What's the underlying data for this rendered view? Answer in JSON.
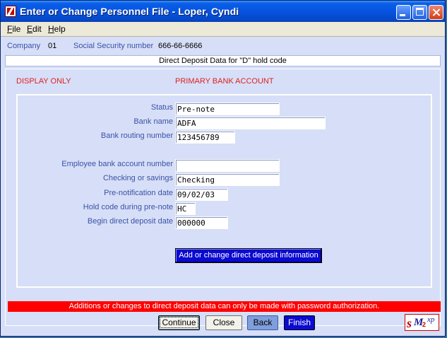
{
  "window": {
    "title": "Enter or Change Personnel File - Loper, Cyndi"
  },
  "menu": {
    "items": [
      {
        "label": "File",
        "accel": "F",
        "rest": "ile"
      },
      {
        "label": "Edit",
        "accel": "E",
        "rest": "dit"
      },
      {
        "label": "Help",
        "accel": "H",
        "rest": "elp"
      }
    ]
  },
  "info": {
    "company_label": "Company",
    "company_value": "01",
    "ssn_label": "Social Security number",
    "ssn_value": "666-66-6666"
  },
  "section_title": "Direct Deposit Data for \"D\" hold code",
  "display_only": "DISPLAY ONLY",
  "primary_account": "PRIMARY BANK ACCOUNT",
  "fields": {
    "status": {
      "label": "Status",
      "value": "Pre-note"
    },
    "bank_name": {
      "label": "Bank name",
      "value": "ADFA"
    },
    "routing": {
      "label": "Bank routing number",
      "value": "123456789"
    },
    "account_number": {
      "label": "Employee bank account number",
      "value": ""
    },
    "checking_savings": {
      "label": "Checking or savings",
      "value": "Checking"
    },
    "prenote_date": {
      "label": "Pre-notification date",
      "value": "09/02/03"
    },
    "hold_code": {
      "label": "Hold code during pre-note",
      "value": "HC"
    },
    "begin_date": {
      "label": "Begin direct deposit date",
      "value": "000000"
    }
  },
  "add_change_button": "Add or change direct deposit information",
  "warning": "Additions or changes to direct deposit data can only be made with password authorization.",
  "buttons": {
    "continue": "Continue",
    "close": "Close",
    "back": "Back",
    "finish": "Finish"
  },
  "logo": {
    "s": "s",
    "m": "M",
    "two": "2",
    "xp": "xp"
  }
}
